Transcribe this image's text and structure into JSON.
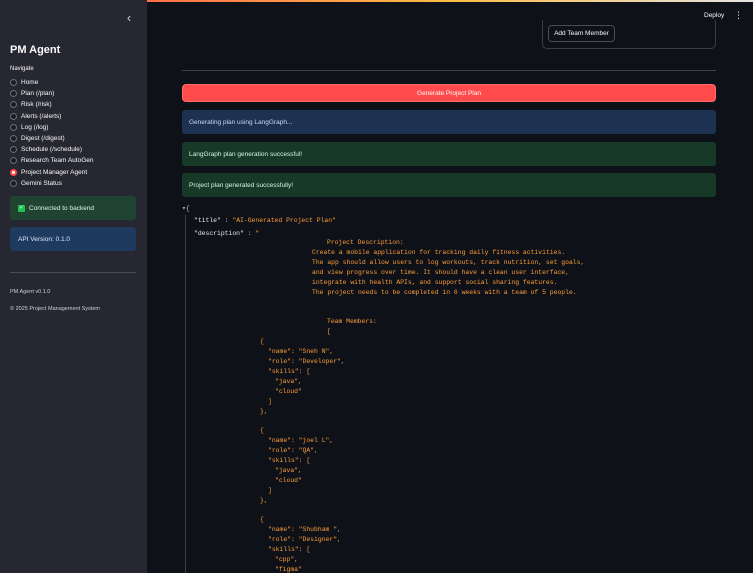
{
  "sidebar": {
    "collapse_icon": "chevron-left-icon",
    "app_title": "PM Agent",
    "nav_label": "Navigate",
    "items": [
      {
        "label": "Home",
        "selected": false
      },
      {
        "label": "Plan (/plan)",
        "selected": false
      },
      {
        "label": "Risk (/risk)",
        "selected": false
      },
      {
        "label": "Alerts (/alerts)",
        "selected": false
      },
      {
        "label": "Log (/log)",
        "selected": false
      },
      {
        "label": "Digest (/digest)",
        "selected": false
      },
      {
        "label": "Schedule (/schedule)",
        "selected": false
      },
      {
        "label": "Research Team AutoGen",
        "selected": false
      },
      {
        "label": "Project Manager Agent",
        "selected": true
      },
      {
        "label": "Gemini Status",
        "selected": false
      }
    ],
    "backend_status": "Connected to backend",
    "api_version": "API Version: 0.1.0",
    "footer_version": "PM Agent v0.1.0",
    "footer_copyright": "© 2025 Project Management System"
  },
  "header": {
    "deploy_label": "Deploy",
    "menu_icon": "kebab-menu-icon"
  },
  "main": {
    "add_member_label": "Add Team Member",
    "generate_label": "Generate Project Plan",
    "alert_info": "Generating plan using LangGraph...",
    "alert_success_1": "LangGraph plan generation successful!",
    "alert_success_2": "Project plan generated successfully!"
  },
  "json_view": {
    "open_brace": "{",
    "title_key": "\"title\"",
    "title_value": "\"AI-Generated Project Plan\"",
    "description_key": "\"description\"",
    "description_open": "\"",
    "lines": [
      "Project Description:",
      "Create a mobile application for tracking daily fitness activities.",
      "The app should allow users to log workouts, track nutrition, set goals,",
      "and view progress over time. It should have a clean user interface,",
      "integrate with health APIs, and support social sharing features.",
      "The project needs to be completed in 6 weeks with a team of 5 people.",
      "Team Members:",
      "[",
      "{",
      "\"name\": \"Sneh N\",",
      "\"role\": \"Developer\",",
      "\"skills\": [",
      "\"java\",",
      "\"cloud\"",
      "]",
      "},",
      "{",
      "\"name\": \"joel L\",",
      "\"role\": \"QA\",",
      "\"skills\": [",
      "\"java\",",
      "\"cloud\"",
      "]",
      "},",
      "{",
      "\"name\": \"Shubham \",",
      "\"role\": \"Designer\",",
      "\"skills\": [",
      "\"cpp\",",
      "\"figma\"",
      "]",
      "}"
    ]
  }
}
